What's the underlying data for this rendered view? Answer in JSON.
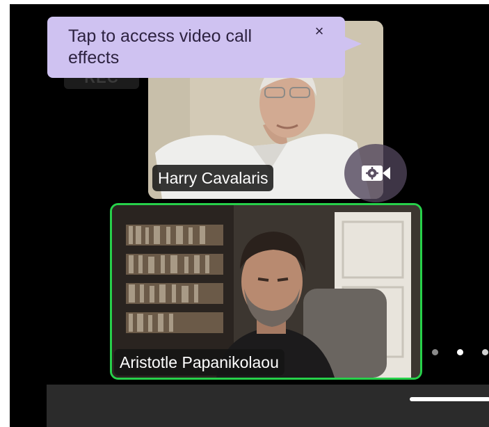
{
  "tooltip": {
    "text": "Tap to access video call effects",
    "close_symbol": "×"
  },
  "rec_badge": {
    "label": "REC"
  },
  "participants": [
    {
      "name": "Harry Cavalaris",
      "active_speaker": false
    },
    {
      "name": "Aristotle Papanikolaou",
      "active_speaker": true
    }
  ],
  "effects_button": {
    "icon": "video-settings-icon"
  },
  "page_indicator": {
    "count": 3,
    "current": 2
  },
  "colors": {
    "tooltip_bg": "#cfc2f1",
    "active_speaker_border": "#27d04a",
    "background": "#000000"
  }
}
